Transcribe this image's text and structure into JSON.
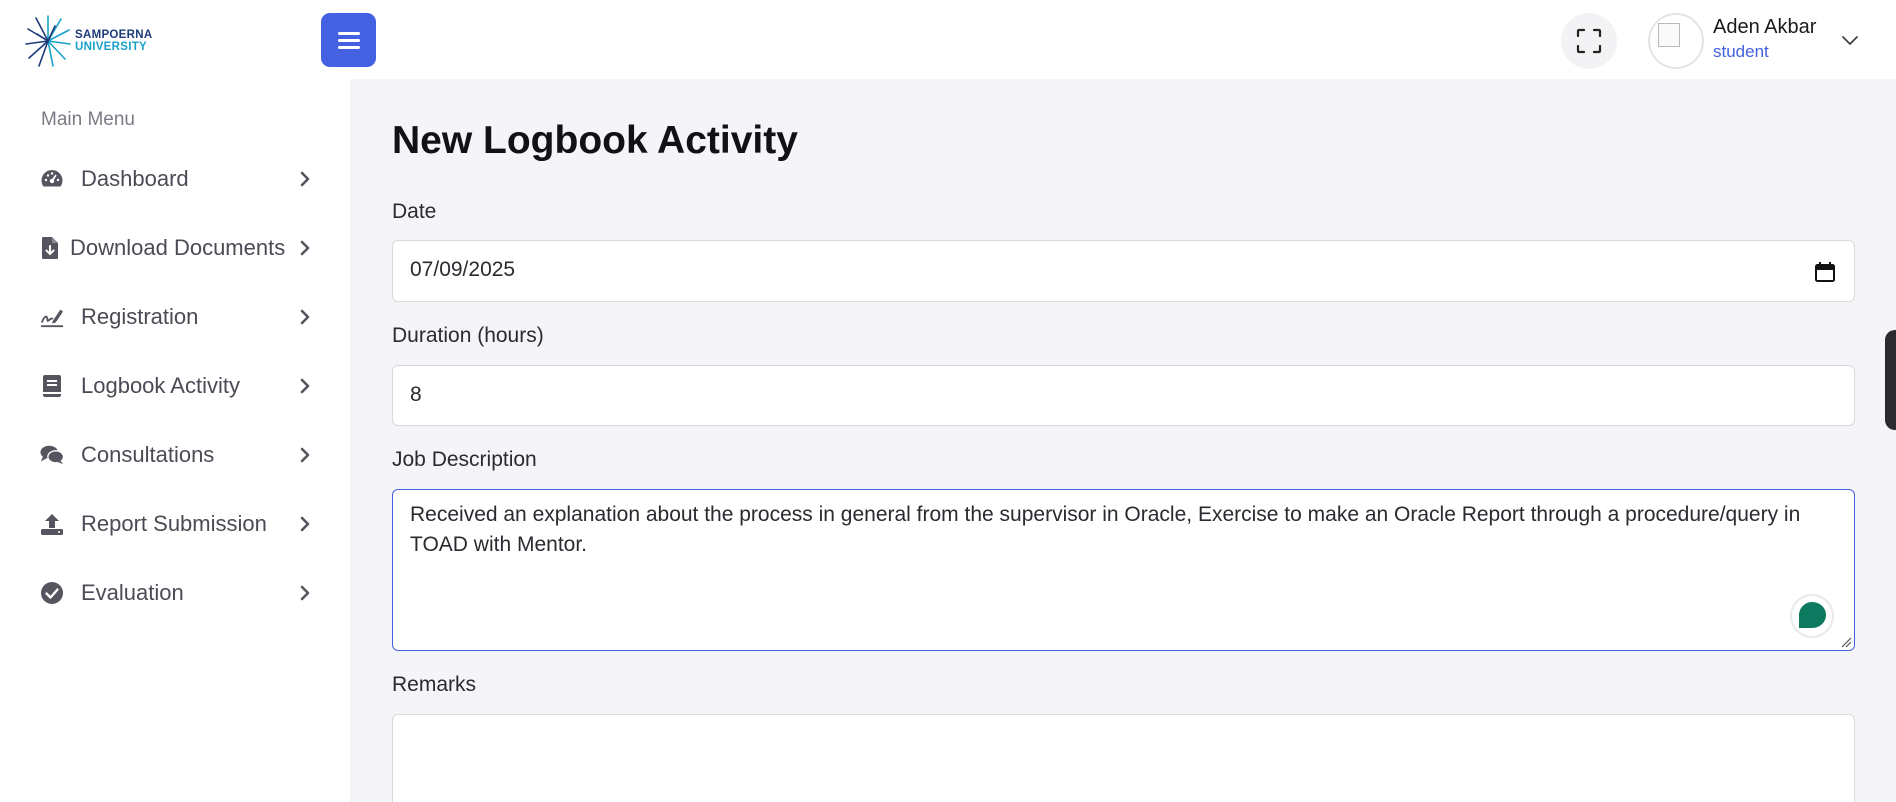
{
  "header": {
    "logo": {
      "line1": "SAMPOERNA",
      "line2": "UNIVERSITY",
      "icon": "sunburst-logo"
    },
    "menu_toggle_icon": "hamburger-icon",
    "fullscreen_icon": "fullscreen-icon",
    "user": {
      "name": "Aden Akbar",
      "role": "student",
      "avatar_icon": "broken-image-icon",
      "dropdown_icon": "chevron-down-icon"
    }
  },
  "sidebar": {
    "title": "Main Menu",
    "items": [
      {
        "label": "Dashboard",
        "icon": "gauge-icon"
      },
      {
        "label": "Download Documents",
        "icon": "file-download-icon"
      },
      {
        "label": "Registration",
        "icon": "signature-icon"
      },
      {
        "label": "Logbook Activity",
        "icon": "book-icon"
      },
      {
        "label": "Consultations",
        "icon": "comments-icon"
      },
      {
        "label": "Report Submission",
        "icon": "upload-icon"
      },
      {
        "label": "Evaluation",
        "icon": "check-circle-icon"
      }
    ]
  },
  "main": {
    "title": "New Logbook Activity",
    "fields": {
      "date": {
        "label": "Date",
        "value": "07/09/2025",
        "icon": "calendar-icon"
      },
      "duration": {
        "label": "Duration (hours)",
        "value": "8"
      },
      "job_description": {
        "label": "Job Description",
        "value": "Received an explanation about the process in general from the supervisor in Oracle, Exercise to make an Oracle Report through a procedure/query in TOAD with Mentor."
      },
      "remarks": {
        "label": "Remarks",
        "value": ""
      }
    }
  },
  "colors": {
    "accent": "#4361e0",
    "sidebar_text": "#4b4b55",
    "assist": "#0d7a5f"
  }
}
